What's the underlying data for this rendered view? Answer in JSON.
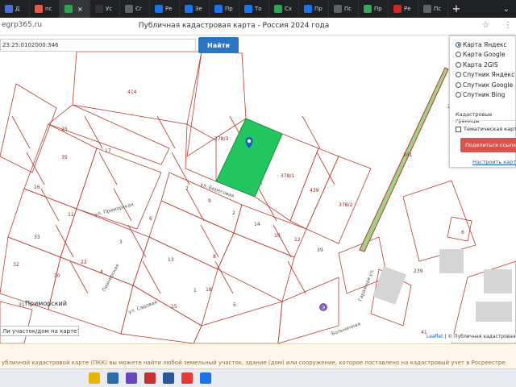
{
  "browser": {
    "tabs": [
      {
        "label": "Д",
        "color": "#4a6fd6"
      },
      {
        "label": "пс",
        "color": "#e8574c"
      },
      {
        "label": "",
        "color": "#2ea44f",
        "active": true
      },
      {
        "label": "Ус",
        "color": "#333333"
      },
      {
        "label": "Cr",
        "color": "#5f6368"
      },
      {
        "label": "Ре",
        "color": "#1a73e8"
      },
      {
        "label": "Зе",
        "color": "#1a73e8"
      },
      {
        "label": "Пр",
        "color": "#1a73e8"
      },
      {
        "label": "То",
        "color": "#1a73e8"
      },
      {
        "label": "Сх",
        "color": "#2ea44f"
      },
      {
        "label": "Пр",
        "color": "#1a73e8"
      },
      {
        "label": "Пс",
        "color": "#5f6368"
      },
      {
        "label": "Пр",
        "color": "#3aa55c"
      },
      {
        "label": "Ре",
        "color": "#cc2a2a"
      },
      {
        "label": "Пс",
        "color": "#5f6368"
      }
    ],
    "active_tab_close": "×",
    "new_tab": "+",
    "window_control": "⌄",
    "url": "egrp365.ru",
    "page_title": "Публичная кадастровая карта - Россия 2024 года",
    "addr_icons": [
      "☆",
      "⋮"
    ]
  },
  "search": {
    "value": "23:25:0102000:346",
    "button_label": "Найти"
  },
  "layers": {
    "options": [
      {
        "label": "Карта Яндекс",
        "selected": true
      },
      {
        "label": "Карта Google",
        "selected": false
      },
      {
        "label": "Карта 2GIS",
        "selected": false
      },
      {
        "label": "Спутник Яндекс",
        "selected": false
      },
      {
        "label": "Спутник Google",
        "selected": false
      },
      {
        "label": "Спутник Bing",
        "selected": false
      }
    ],
    "section_label": "Кадастровые границы",
    "thematic_label": "Тематическая карта",
    "share_label": "Поделиться ссылкой",
    "setup_link": "Настроить карту"
  },
  "map": {
    "highlight_color": "#22c55e",
    "boundary_color": "#c0392b",
    "parcel_numbers": [
      "414",
      "378/3",
      "378/1",
      "439",
      "378/2",
      "25",
      "16",
      "17",
      "7",
      "9",
      "6",
      "11",
      "14",
      "2",
      "10",
      "12",
      "39",
      "3",
      "4",
      "5",
      "8",
      "1",
      "13",
      "18",
      "22",
      "15",
      "30",
      "32",
      "33",
      "31",
      "35",
      "241",
      "6",
      "239",
      "21",
      "41"
    ],
    "streets": [
      "ул. Береговая",
      "ул. Приморская",
      "Пионерская",
      "Гаражная ул.",
      "Больничная",
      "ул. Садовая"
    ],
    "place_name": "Приморский",
    "question": "Ли участок/дом на карте?",
    "attribution_leaflet": "Leaflet",
    "attribution_text": " | © Публичная кадастровая"
  },
  "page_text": "убличной кадастровой карте (ПКК) вы можете найти любой земельный участок, здание (дом) или сооружение, которое поставлено на кадастровый учет в Росреестре",
  "taskbar": [
    {
      "icon": "explorer-icon",
      "color": "#e8b500"
    },
    {
      "icon": "window-icon",
      "color": "#2b6cb0"
    },
    {
      "icon": "media-icon",
      "color": "#6b46c1"
    },
    {
      "icon": "powerpoint-icon",
      "color": "#c53030"
    },
    {
      "icon": "word-icon",
      "color": "#2b579a"
    },
    {
      "icon": "yandex-icon",
      "color": "#e53935"
    },
    {
      "icon": "edge-icon",
      "color": "#1a73e8"
    }
  ]
}
